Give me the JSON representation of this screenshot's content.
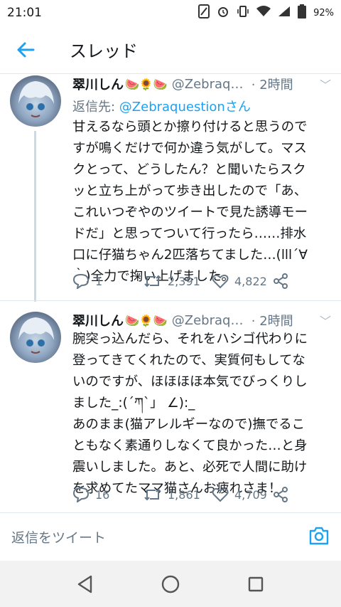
{
  "status_bar": {
    "time": "21:01",
    "battery": "92%"
  },
  "header": {
    "title": "スレッド"
  },
  "tweets": [
    {
      "name": "翠川しん",
      "emojis": "🍉🌻🍉",
      "handle": "@Zebraqu...",
      "time": "· 2時間",
      "reply_prefix": "返信先: ",
      "reply_mention": "@Zebraquestionさん",
      "text": "甘えるなら頭とか擦り付けると思うので\nすが鳴くだけで何か違う気がして。マス\nクとって、どうしたん？と聞いたらスク\nッと立ち上がって歩き出したので「あ、\nこれいつぞやのツイートで見た誘導モー\nドだ」と思ってついて行ったら……排水\n口に仔猫ちゃん2匹落ちてました…(lll´∀\n｀)全力で掬い上げました。",
      "replies": "1",
      "retweets": "2,391",
      "likes": "4,822"
    },
    {
      "name": "翠川しん",
      "emojis": "🍉🌻🍉",
      "handle": "@Zebraqu...",
      "time": "· 2時間",
      "text": "腕突っ込んだら、それをハシゴ代わりに\n登ってきてくれたので、実質何もしてな\nいのですが、ほほほほ本気でびっくりし\nました_:(´ཀ`」 ∠):_\nあのまま(猫アレルギーなので)撫でるこ\nともなく素通りしなくて良かった…と身\n震いしました。あと、必死で人間に助け\nを求めてたママ猫さんお疲れさま！",
      "replies": "16",
      "retweets": "1,861",
      "likes": "4,709"
    }
  ],
  "reply_bar": {
    "placeholder": "返信をツイート"
  },
  "colors": {
    "accent": "#1da1f2",
    "secondary_text": "#657786"
  }
}
